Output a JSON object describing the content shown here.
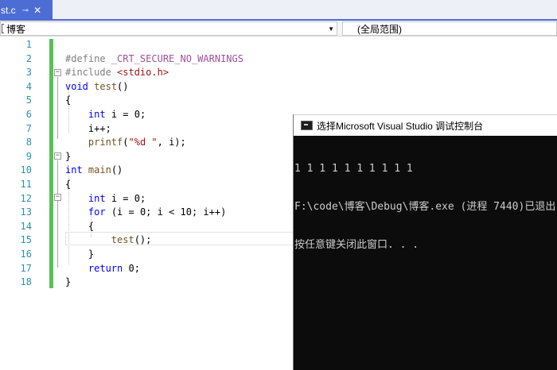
{
  "tab": {
    "title": "st.c",
    "pin_glyph": "⊸",
    "close_glyph": "✕"
  },
  "navbar": {
    "project": "博客",
    "scope": "(全局范围)"
  },
  "editor": {
    "line_numbers": [
      "1",
      "2",
      "3",
      "4",
      "5",
      "6",
      "7",
      "8",
      "9",
      "10",
      "11",
      "12",
      "13",
      "14",
      "15",
      "16",
      "17",
      "18"
    ]
  },
  "console": {
    "title": "选择Microsoft Visual Studio 调试控制台",
    "lines": [
      "1 1 1 1 1 1 1 1 1 1",
      "F:\\code\\博客\\Debug\\博客.exe (进程 7440)已退出",
      "按任意键关闭此窗口. . ."
    ]
  },
  "colors": {
    "accent": "#4d6cd4",
    "keyword": "#0000ff",
    "preprocessor": "#808080",
    "macro": "#a050a0",
    "string": "#a31515",
    "line_number": "#2b91af",
    "change_bar": "#57c257",
    "console_bg": "#0c0c0c",
    "console_fg": "#cccccc"
  }
}
